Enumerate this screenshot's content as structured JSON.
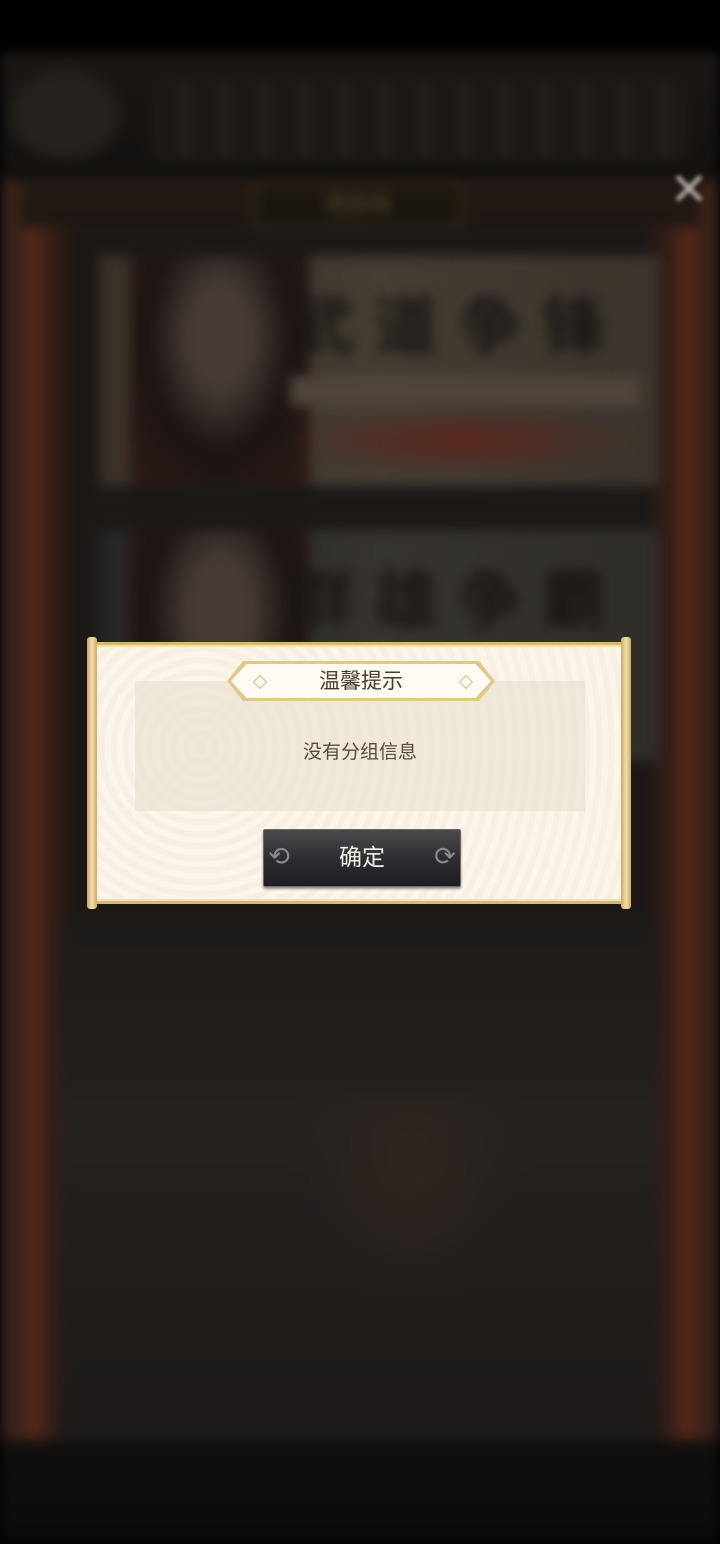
{
  "background": {
    "plaque_text": "竞技场",
    "banner_1_title": "武道争锋",
    "banner_2_title": "群雄争霸"
  },
  "close_button": {
    "icon": "close-x-icon",
    "glyph": "✕"
  },
  "dialog": {
    "title": "温馨提示",
    "message": "没有分组信息",
    "confirm_label": "确定"
  },
  "colors": {
    "dialog_bg": "#fbf5ea",
    "dialog_border": "#d8b878",
    "button_bg": "#2c2c30",
    "text_dark": "#4a3a2c"
  }
}
